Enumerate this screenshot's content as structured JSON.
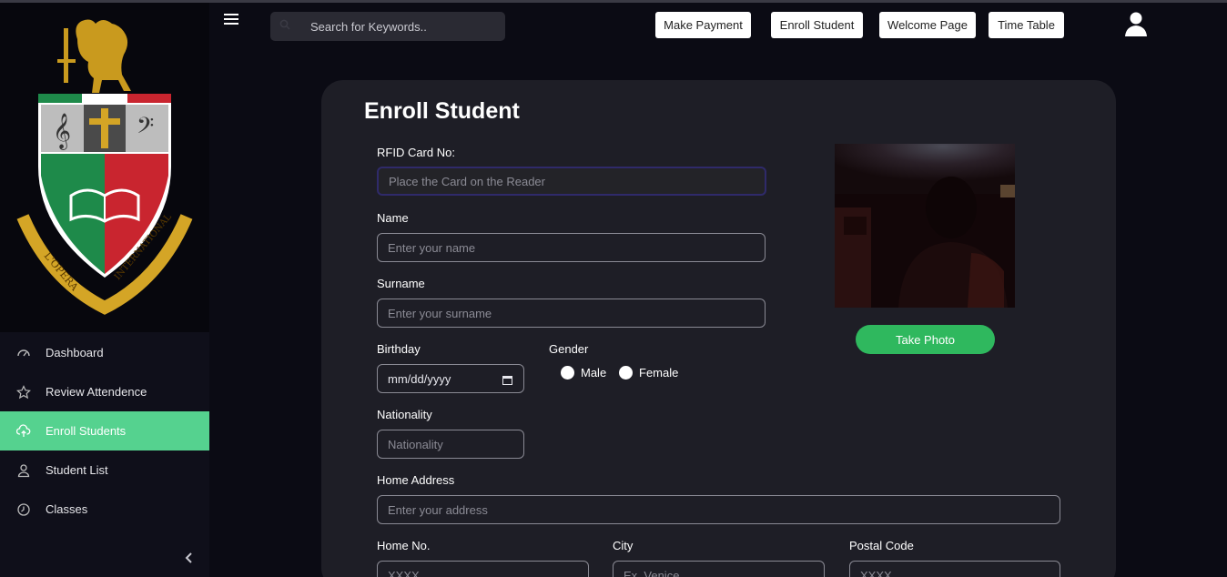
{
  "search": {
    "placeholder": "Search for Keywords.."
  },
  "topbar": {
    "buttons": [
      "Make Payment",
      "Enroll Student",
      "Welcome Page",
      "Time Table"
    ]
  },
  "sidebar": {
    "items": [
      {
        "label": "Dashboard",
        "icon": "dashboard-gauge-icon"
      },
      {
        "label": "Review Attendence",
        "icon": "star-icon"
      },
      {
        "label": "Enroll Students",
        "icon": "cloud-upload-icon",
        "active": true
      },
      {
        "label": "Student List",
        "icon": "user-icon"
      },
      {
        "label": "Classes",
        "icon": "clock-icon"
      }
    ],
    "accent": "#55d28f"
  },
  "form": {
    "title": "Enroll Student",
    "rfid": {
      "label": "RFID Card No:",
      "placeholder": "Place the Card on the Reader"
    },
    "name": {
      "label": "Name",
      "placeholder": "Enter your name"
    },
    "surname": {
      "label": "Surname",
      "placeholder": "Enter your surname"
    },
    "birthday": {
      "label": "Birthday",
      "value": "mm/dd/yyyy"
    },
    "gender": {
      "label": "Gender",
      "options": [
        "Male",
        "Female"
      ]
    },
    "nationality": {
      "label": "Nationality",
      "placeholder": "Nationality"
    },
    "address": {
      "label": "Home Address",
      "placeholder": "Enter your address"
    },
    "home_no": {
      "label": "Home No.",
      "placeholder": "XXXX"
    },
    "city": {
      "label": "City",
      "placeholder": "Ex. Venice"
    },
    "postal": {
      "label": "Postal Code",
      "placeholder": "XXXX"
    },
    "take_photo": "Take Photo"
  },
  "colors": {
    "primary_button": "#2fb85e",
    "card_bg": "#1e1e26",
    "page_bg": "#0b0b14"
  }
}
